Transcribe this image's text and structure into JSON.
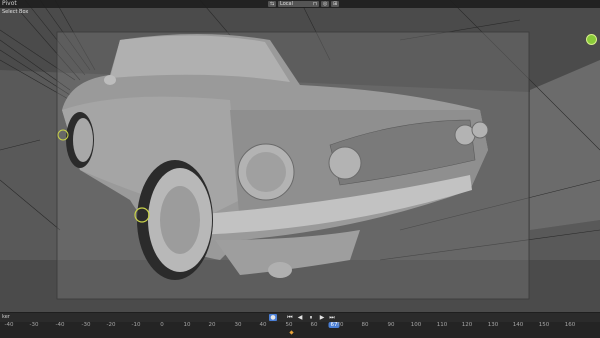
{
  "app": {
    "title": "Blender 3D viewport"
  },
  "topbar": {
    "pivot_label": "Pivot",
    "transform_orientation": "Local",
    "snap_icon": "magnet-icon",
    "proportional_icon": "circle-icon",
    "mode_icon": "grid-icon"
  },
  "viewport": {
    "tool_label": "Select Box",
    "gizmo_icon": "navigation-gizmo-icon",
    "object": "car-model"
  },
  "timeline": {
    "menu_label": "ker",
    "buttons": [
      "record-icon",
      "jump-start-icon",
      "prev-keyframe-icon",
      "play-icon",
      "next-keyframe-icon",
      "jump-end-icon"
    ],
    "ticks": [
      "-40",
      "-30",
      "-40",
      "-30",
      "-20",
      "-10",
      "0",
      "10",
      "20",
      "30",
      "40",
      "50",
      "60",
      "67",
      "70",
      "80",
      "90",
      "100",
      "110",
      "120",
      "130",
      "140",
      "150",
      "160"
    ],
    "current_frame": "67"
  },
  "colors": {
    "accent": "#4a7fd6",
    "keyframe": "#e8a33a",
    "gizmo": "#8acb3a"
  }
}
